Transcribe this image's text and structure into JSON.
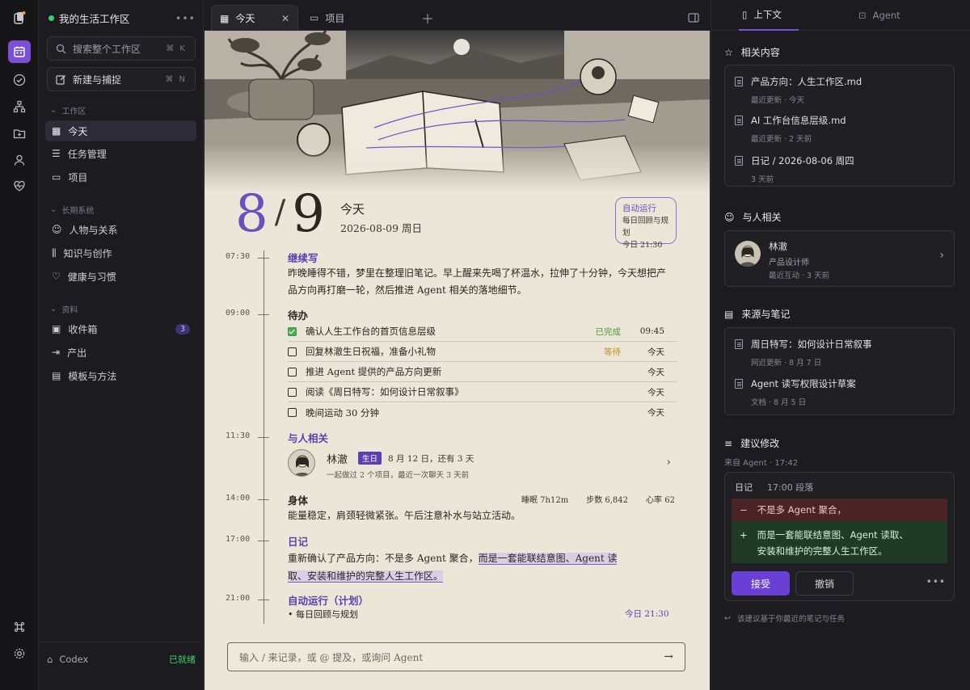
{
  "sidebar": {
    "workspace_name": "我的生活工作区",
    "search_placeholder": "搜索整个工作区",
    "search_shortcut": "⌘ K",
    "new_capture": "新建与捕捉",
    "new_shortcut": "⌘ N",
    "sections": {
      "workspace": "工作区",
      "long_term": "长期系统",
      "resources": "资料"
    },
    "items": [
      {
        "label": "今天"
      },
      {
        "label": "任务管理"
      },
      {
        "label": "项目"
      },
      {
        "label": "人物与关系"
      },
      {
        "label": "知识与创作"
      },
      {
        "label": "健康与习惯"
      },
      {
        "label": "收件箱",
        "badge": "3"
      },
      {
        "label": "产出"
      },
      {
        "label": "模板与方法"
      }
    ],
    "codex_label": "Codex",
    "codex_status": "已就绪"
  },
  "tabs": [
    {
      "label": "今天"
    },
    {
      "label": "项目"
    }
  ],
  "main": {
    "date_month": "8",
    "date_day": "9",
    "title": "今天",
    "date_full": "2026-08-09  周日",
    "auto_box": {
      "title": "自动运行",
      "line1": "每日回顾与规划",
      "line2": "今日 21:30"
    },
    "times": [
      "07:30",
      "09:00",
      "11:30",
      "14:00",
      "17:00",
      "21:00"
    ],
    "continue": {
      "heading": "继续写",
      "text": "昨晚睡得不错，梦里在整理旧笔记。早上醒来先喝了杯温水，拉伸了十分钟，今天想把产品方向再打磨一轮，然后推进 Agent 相关的落地细节。"
    },
    "todo": {
      "heading": "待办",
      "items": [
        {
          "text": "确认人生工作台的首页信息层级",
          "status": "已完成",
          "date": "09:45",
          "done": true
        },
        {
          "text": "回复林澈生日祝福，准备小礼物",
          "status": "等待",
          "date": "今天",
          "done": false
        },
        {
          "text": "推进 Agent 提供的产品方向更新",
          "status": "",
          "date": "今天",
          "done": false
        },
        {
          "text": "阅读《周日特写：如何设计日常叙事》",
          "status": "",
          "date": "今天",
          "done": false
        },
        {
          "text": "晚间运动 30 分钟",
          "status": "",
          "date": "今天",
          "done": false
        }
      ]
    },
    "people": {
      "heading": "与人相关",
      "name": "林澈",
      "tag": "生日",
      "date": "8 月 12 日，还有 3 天",
      "sub": "一起做过 2 个项目，最近一次聊天 3 天前"
    },
    "body": {
      "heading": "身体",
      "sleep": "睡眠 7h12m",
      "steps": "步数 6,842",
      "heart": "心率 62",
      "text": "能量稳定，肩颈轻微紧张。午后注意补水与站立活动。"
    },
    "journal": {
      "heading": "日记",
      "text_a": "重新确认了产品方向：不是多 Agent 聚合，",
      "text_b": "而是一套能联结意图、Agent 读",
      "text_c": "取、安装和维护的完整人生工作区。"
    },
    "auto": {
      "heading": "自动运行（计划）",
      "item": "每日回顾与规划",
      "time": "今日 21:30"
    },
    "input_placeholder": "输入 / 来记录，或 @ 提及，或询问 Agent"
  },
  "right": {
    "tabs": [
      {
        "label": "上下文"
      },
      {
        "label": "Agent"
      }
    ],
    "related": {
      "heading": "相关内容",
      "items": [
        {
          "title": "产品方向：人生工作区.md",
          "meta": "最近更新 · 今天"
        },
        {
          "title": "AI 工作台信息层级.md",
          "meta": "最近更新 · 2 天前"
        },
        {
          "title": "日记 / 2026-08-06 周四",
          "meta": "3 天前"
        }
      ]
    },
    "person": {
      "heading": "与人相关",
      "name": "林澈",
      "role": "产品设计师",
      "meta": "最近互动 · 3 天前"
    },
    "sources": {
      "heading": "来源与笔记",
      "items": [
        {
          "title": "周日特写：如何设计日常叙事",
          "meta": "网近更新 · 8 月 7 日"
        },
        {
          "title": "Agent 读写权限设计草案",
          "meta": "文档 · 8 月 5 日"
        }
      ]
    },
    "suggest": {
      "heading": "建议修改",
      "from": "来自 Agent · 17:42",
      "doc": "日记",
      "para": "17:00 段落",
      "del_text": "不是多 Agent 聚合，",
      "ins_line1": "而是一套能联结意图、Agent 读取、",
      "ins_line2": "安装和维护的完整人生工作区。",
      "accept": "接受",
      "undo": "撤销"
    },
    "footer": "该建议基于你最近的笔记与任务"
  },
  "colors": {
    "accent": "#7b4fd6",
    "paper": "#ece6d8",
    "ready": "#3ecf6e"
  }
}
